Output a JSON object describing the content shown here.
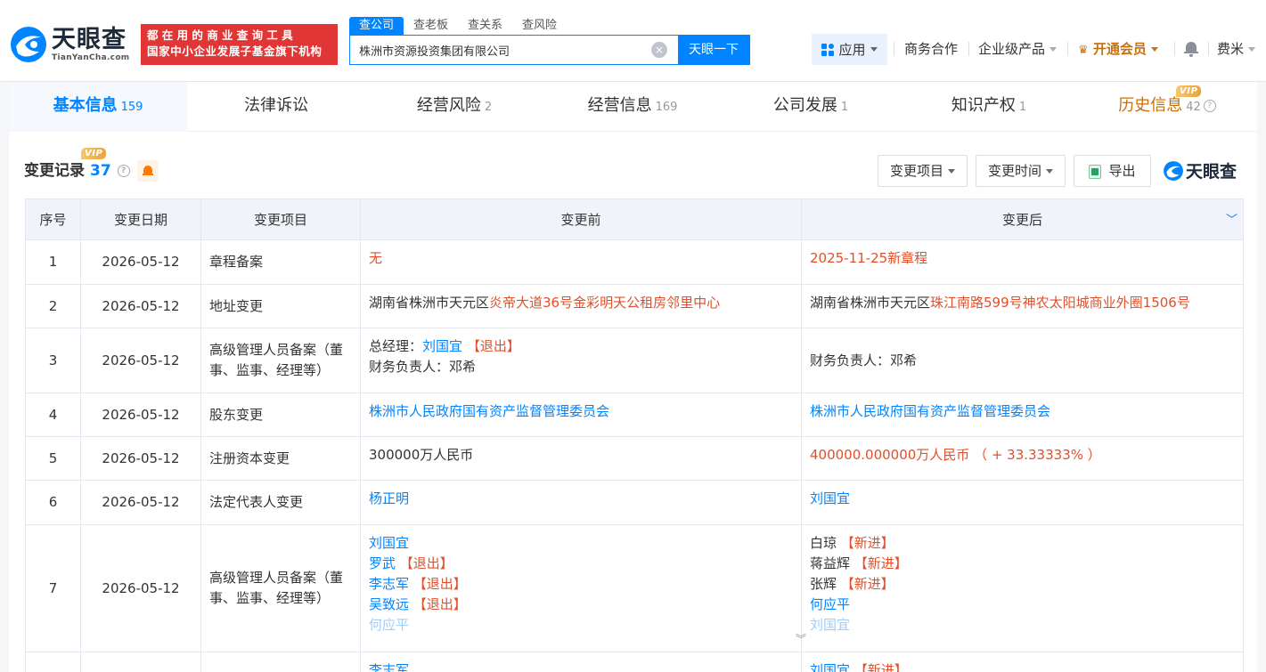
{
  "brand": {
    "name_cn": "天眼查",
    "name_en": "TianYanCha.com",
    "slogan_line1": "都在用的商业查询工具",
    "slogan_line2": "国家中小企业发展子基金旗下机构"
  },
  "search": {
    "tabs": [
      "查公司",
      "查老板",
      "查关系",
      "查风险"
    ],
    "value": "株洲市资源投资集团有限公司",
    "clear_icon": "×",
    "button": "天眼一下"
  },
  "topnav": {
    "app": "应用",
    "business": "商务合作",
    "enterprise": "企业级产品",
    "vip": "开通会员",
    "user": "费米"
  },
  "tabs": [
    {
      "label": "基本信息",
      "count": "159"
    },
    {
      "label": "法律诉讼",
      "count": ""
    },
    {
      "label": "经营风险",
      "count": "2"
    },
    {
      "label": "经营信息",
      "count": "169"
    },
    {
      "label": "公司发展",
      "count": "1"
    },
    {
      "label": "知识产权",
      "count": "1"
    },
    {
      "label": "历史信息",
      "count": "42"
    }
  ],
  "vip_label": "VIP",
  "section": {
    "title": "变更记录",
    "count": "37",
    "help": "?"
  },
  "toolbar": {
    "filter_item": "变更项目",
    "filter_time": "变更时间",
    "export": "导出",
    "brand": "天眼查"
  },
  "table": {
    "headers": [
      "序号",
      "变更日期",
      "变更项目",
      "变更前",
      "变更后"
    ],
    "rows": [
      {
        "no": "1",
        "date": "2026-05-12",
        "item": "章程备案",
        "before": "无",
        "after": "2025-11-25新章程"
      },
      {
        "no": "2",
        "date": "2026-05-12",
        "item": "地址变更",
        "before_prefix": "湖南省株洲市天元区",
        "before_hl": "炎帝大道36号金彩明天公租房邻里中心",
        "after_prefix": "湖南省株洲市天元区",
        "after_hl": "珠江南路599号神农太阳城商业外圈1506号"
      },
      {
        "no": "3",
        "date": "2026-05-12",
        "item": "高级管理人员备案（董事、监事、经理等）",
        "before_l1_label": "总经理：",
        "before_l1_name": "刘国宜",
        "before_l1_tag": "【退出】",
        "before_l2": "财务负责人：邓希",
        "after": "财务负责人：邓希"
      },
      {
        "no": "4",
        "date": "2026-05-12",
        "item": "股东变更",
        "before": "株洲市人民政府国有资产监督管理委员会",
        "after": "株洲市人民政府国有资产监督管理委员会"
      },
      {
        "no": "5",
        "date": "2026-05-12",
        "item": "注册资本变更",
        "before": "300000万人民币",
        "after": "400000.000000万人民币 （ + 33.33333% ）"
      },
      {
        "no": "6",
        "date": "2026-05-12",
        "item": "法定代表人变更",
        "before": "杨正明",
        "after": "刘国宜"
      },
      {
        "no": "7",
        "date": "2026-05-12",
        "item": "高级管理人员备案（董事、监事、经理等）",
        "before_list": [
          {
            "name": "刘国宜",
            "tag": ""
          },
          {
            "name": "罗武",
            "tag": "【退出】"
          },
          {
            "name": "李志军",
            "tag": "【退出】"
          },
          {
            "name": "吴致远",
            "tag": "【退出】"
          },
          {
            "name": "何应平",
            "tag": ""
          }
        ],
        "after_list": [
          {
            "name": "白琼",
            "tag": "【新进】"
          },
          {
            "name": "蒋益辉",
            "tag": "【新进】"
          },
          {
            "name": "张辉",
            "tag": "【新进】"
          },
          {
            "name": "何应平",
            "tag": ""
          },
          {
            "name": "刘国宜",
            "tag": ""
          }
        ]
      },
      {
        "before_partial": "李志军",
        "after_partial_name": "刘国宜",
        "after_partial_tag": "【新进】"
      }
    ]
  }
}
